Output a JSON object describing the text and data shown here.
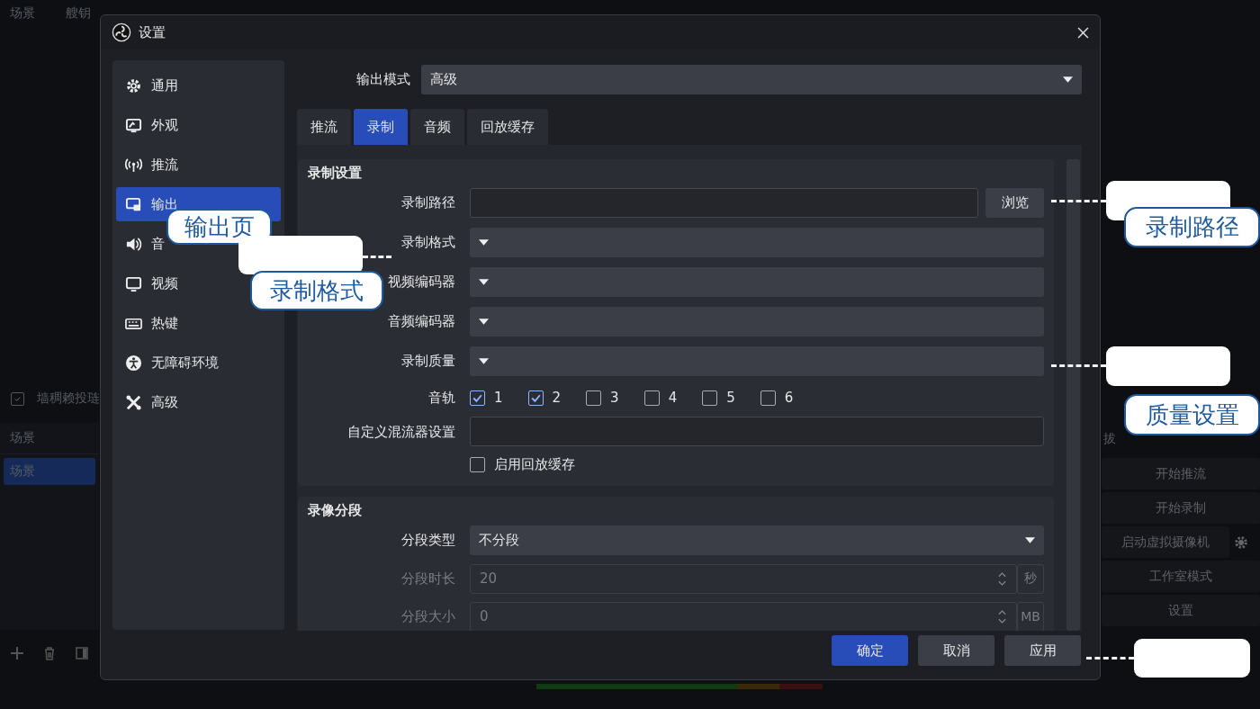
{
  "background": {
    "menu": [
      "场景",
      "艘钥"
    ],
    "toolbar_checkbox": {
      "label": "墙稠赖投琏",
      "checked": true
    },
    "scenes": {
      "title": "场景",
      "items": [
        {
          "label": "场景",
          "selected": true
        }
      ]
    },
    "controls": {
      "title": "拔",
      "buttons": [
        "开始推流",
        "开始录制",
        "启动虚拟摄像机",
        "工作室模式",
        "设置"
      ]
    }
  },
  "dialog": {
    "title": "设置",
    "sidebar": [
      {
        "label": "通用",
        "selected": false
      },
      {
        "label": "外观",
        "selected": false
      },
      {
        "label": "推流",
        "selected": false
      },
      {
        "label": "输出",
        "selected": true
      },
      {
        "label": "音",
        "selected": false
      },
      {
        "label": "视频",
        "selected": false
      },
      {
        "label": "热键",
        "selected": false
      },
      {
        "label": "无障碍环境",
        "selected": false
      },
      {
        "label": "高级",
        "selected": false
      }
    ],
    "output_mode": {
      "label": "输出模式",
      "value": "高级"
    },
    "tabs": [
      {
        "label": "推流",
        "selected": false
      },
      {
        "label": "录制",
        "selected": true
      },
      {
        "label": "音频",
        "selected": false
      },
      {
        "label": "回放缓存",
        "selected": false
      }
    ],
    "sections": [
      {
        "title": "录制设置",
        "rows": [
          {
            "kind": "path",
            "label": "录制路径",
            "button": "浏览"
          },
          {
            "kind": "select",
            "label": "录制格式"
          },
          {
            "kind": "select",
            "label": "视频编码器"
          },
          {
            "kind": "select",
            "label": "音频编码器"
          },
          {
            "kind": "select",
            "label": "录制质量"
          },
          {
            "kind": "tracks",
            "label": "音轨",
            "tracks": [
              {
                "label": "1",
                "checked": true
              },
              {
                "label": "2",
                "checked": true
              },
              {
                "label": "3",
                "checked": false
              },
              {
                "label": "4",
                "checked": false
              },
              {
                "label": "5",
                "checked": false
              },
              {
                "label": "6",
                "checked": false
              }
            ]
          },
          {
            "kind": "text",
            "label": "自定义混流器设置"
          },
          {
            "kind": "checkbox",
            "label": "启用回放缓存",
            "checked": false
          }
        ]
      },
      {
        "title": "录像分段",
        "rows": [
          {
            "kind": "select",
            "label": "分段类型",
            "value": "不分段"
          },
          {
            "kind": "spin",
            "label": "分段时长",
            "value": "20",
            "unit": "秒",
            "disabled": true
          },
          {
            "kind": "spin",
            "label": "分段大小",
            "value": "0",
            "unit": "MB",
            "disabled": true
          }
        ]
      }
    ],
    "buttons": [
      "确定",
      "取消",
      "应用"
    ]
  },
  "annotations": [
    {
      "kind": "bubble",
      "text": "输出页"
    },
    {
      "kind": "blank"
    },
    {
      "kind": "bubble",
      "text": "录制格式"
    },
    {
      "kind": "blank"
    },
    {
      "kind": "bubble",
      "text": "录制路径"
    },
    {
      "kind": "blank"
    },
    {
      "kind": "bubble",
      "text": "质量设置"
    },
    {
      "kind": "blank"
    }
  ]
}
